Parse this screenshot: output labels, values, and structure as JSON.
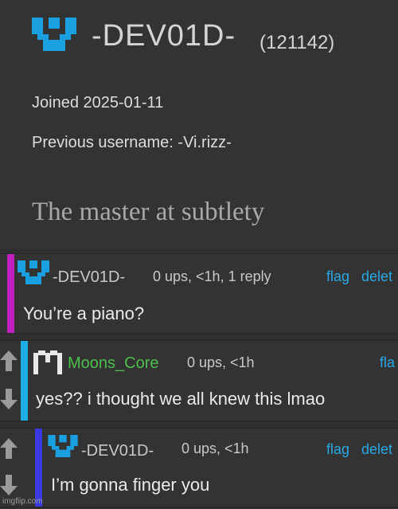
{
  "profile": {
    "username": "-DEV01D-",
    "user_id": "(121142)",
    "joined": "Joined 2025-01-11",
    "previous_username": "Previous username: -Vi.rizz-",
    "bio": "The master at subtlety"
  },
  "comments": [
    {
      "author": "-DEV01D-",
      "meta": "0 ups, <1h, 1 reply",
      "text": "You’re a piano?",
      "flag_label": "flag",
      "delete_label": "delet",
      "accent_color": "#c21fc2"
    },
    {
      "author": "Moons_Core",
      "meta": "0 ups, <1h",
      "text": "yes?? i thought we all knew this lmao",
      "flag_label": "fla",
      "accent_color": "#1eaee6"
    },
    {
      "author": "-DEV01D-",
      "meta": "0 ups, <1h",
      "text": "I’m gonna finger you",
      "flag_label": "flag",
      "delete_label": "delet",
      "accent_color": "#3a3ae0"
    }
  ],
  "colors": {
    "link": "#2aa8e6",
    "green_name": "#4bc04b",
    "logo": "#1aa0e0"
  },
  "watermark": "imgflip.com"
}
